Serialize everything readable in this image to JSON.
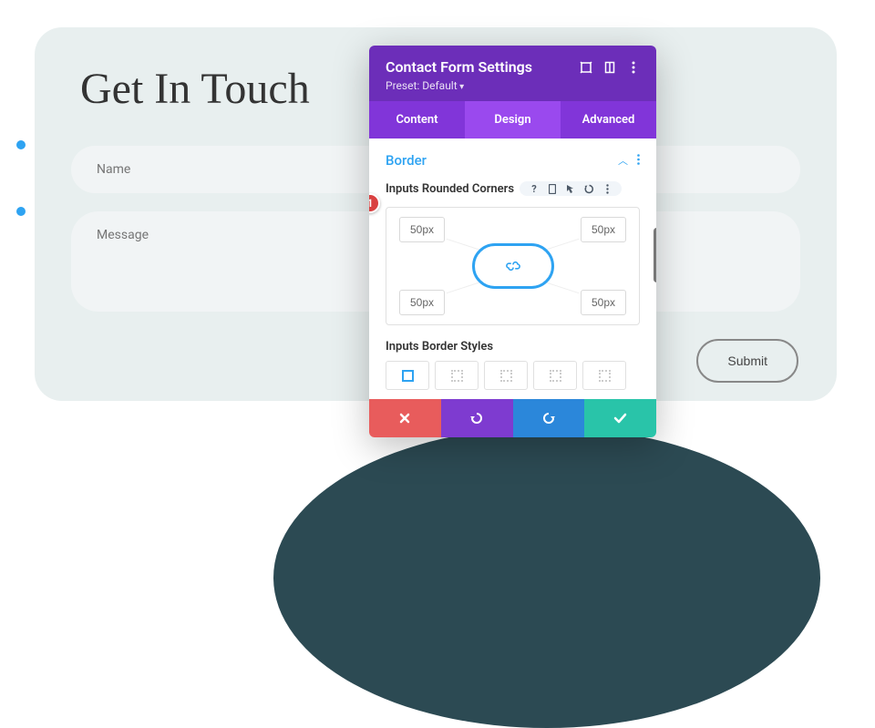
{
  "page": {
    "title": "Get In Touch",
    "fields": {
      "name_placeholder": "Name",
      "message_placeholder": "Message"
    },
    "submit_label": "Submit"
  },
  "panel": {
    "title": "Contact Form Settings",
    "preset": "Preset: Default",
    "tabs": [
      "Content",
      "Design",
      "Advanced"
    ],
    "active_tab": 1,
    "section": "Border",
    "option_label": "Inputs Rounded Corners",
    "corners": {
      "tl": "50px",
      "tr": "50px",
      "bl": "50px",
      "br": "50px"
    },
    "border_styles_label": "Inputs Border Styles",
    "badge": "1"
  }
}
